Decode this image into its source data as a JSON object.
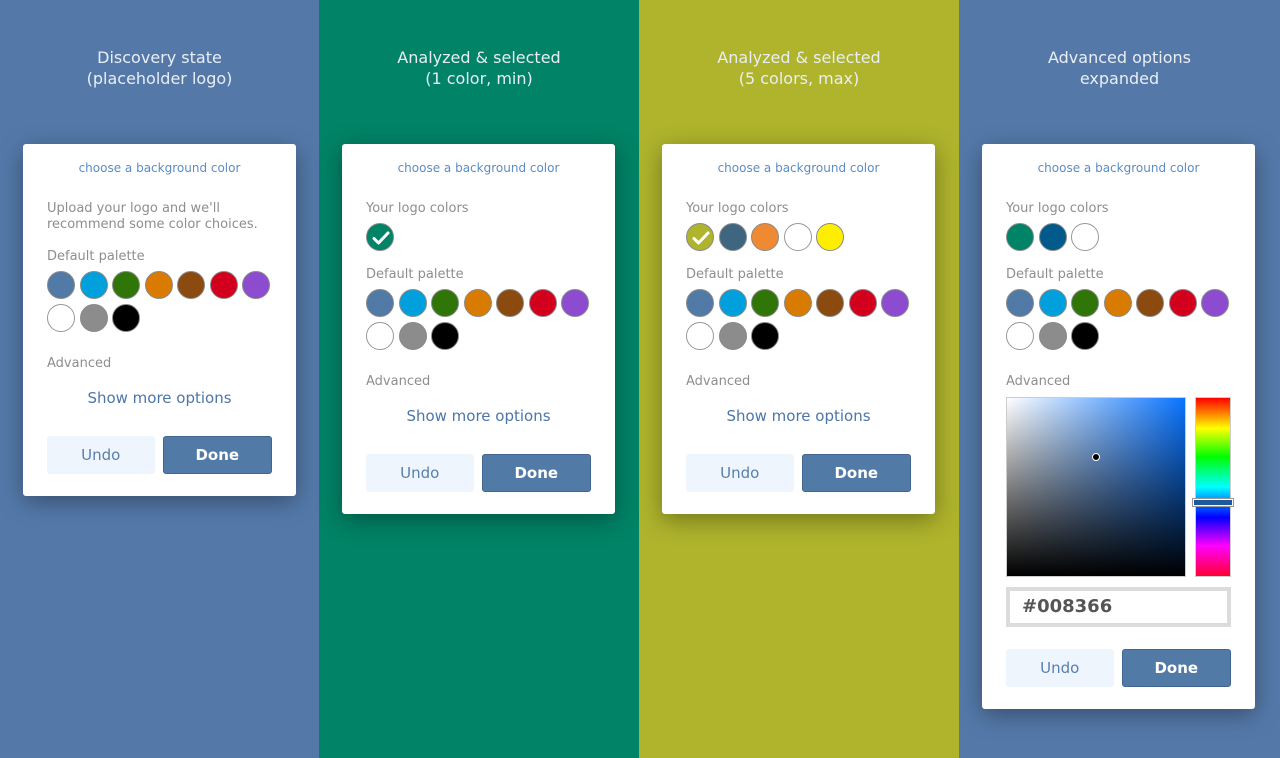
{
  "common": {
    "card_title": "choose a background color",
    "logo_colors_label": "Your logo colors",
    "default_palette_label": "Default palette",
    "advanced_label": "Advanced",
    "show_more": "Show more options",
    "undo": "Undo",
    "done": "Done",
    "upload_hint": "Upload your logo and we'll recommend some color choices."
  },
  "default_palette": [
    [
      "#527aa6",
      "#00a0dc",
      "#2f7507",
      "#d97b00",
      "#8a4a10",
      "#d2001c",
      "#8d4ccf"
    ],
    [
      "#ffffff",
      "#8c8c8c",
      "#000000"
    ]
  ],
  "panels": [
    {
      "bg": "#5479a9",
      "title": [
        "Discovery state",
        "(placeholder logo)"
      ],
      "logo_colors": null,
      "advanced_expanded": false
    },
    {
      "bg": "#008366",
      "title": [
        "Analyzed & selected",
        "(1 color, min)"
      ],
      "logo_colors": [
        {
          "color": "#008366",
          "selected": true
        }
      ],
      "advanced_expanded": false
    },
    {
      "bg": "#afb42c",
      "title": [
        "Analyzed & selected",
        "(5 colors, max)"
      ],
      "logo_colors": [
        {
          "color": "#afb42c",
          "selected": true
        },
        {
          "color": "#3e6680",
          "selected": false
        },
        {
          "color": "#ef8a33",
          "selected": false
        },
        {
          "color": "#ffffff",
          "selected": false
        },
        {
          "color": "#ffee00",
          "selected": false
        }
      ],
      "advanced_expanded": false
    },
    {
      "bg": "#5479a9",
      "title": [
        "Advanced options",
        "expanded"
      ],
      "logo_colors": [
        {
          "color": "#008366",
          "selected": false
        },
        {
          "color": "#005a8c",
          "selected": false
        },
        {
          "color": "#ffffff",
          "selected": false
        }
      ],
      "advanced_expanded": true,
      "hex_value": "#008366"
    }
  ]
}
